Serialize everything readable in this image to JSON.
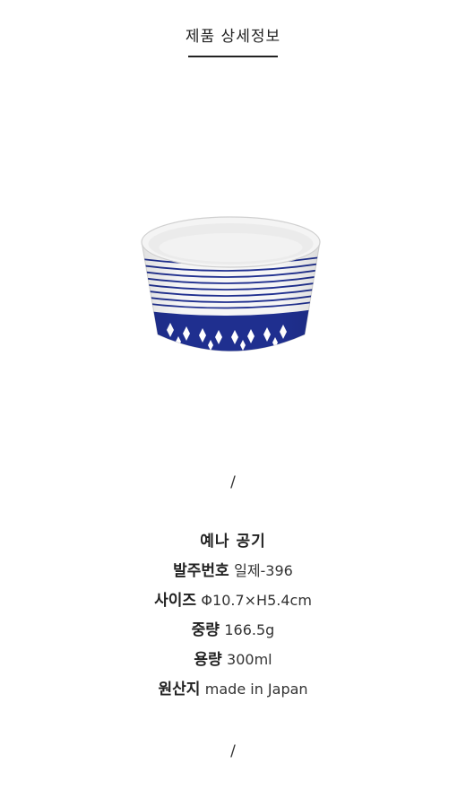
{
  "header": {
    "title": "제품 상세정보"
  },
  "image": {
    "alt": "blue and white porcelain bowl"
  },
  "separator": "/",
  "product": {
    "name": "예나 공기",
    "specs": [
      {
        "label": "발주번호",
        "value": "일제-396"
      },
      {
        "label": "사이즈",
        "value": "Φ10.7×H5.4cm"
      },
      {
        "label": "중량",
        "value": "166.5g"
      },
      {
        "label": "용량",
        "value": "300ml"
      },
      {
        "label": "원산지",
        "value": "made in Japan"
      }
    ]
  },
  "colors": {
    "cobalt": "#1f2f8f",
    "porcelain": "#f7f7f7"
  }
}
